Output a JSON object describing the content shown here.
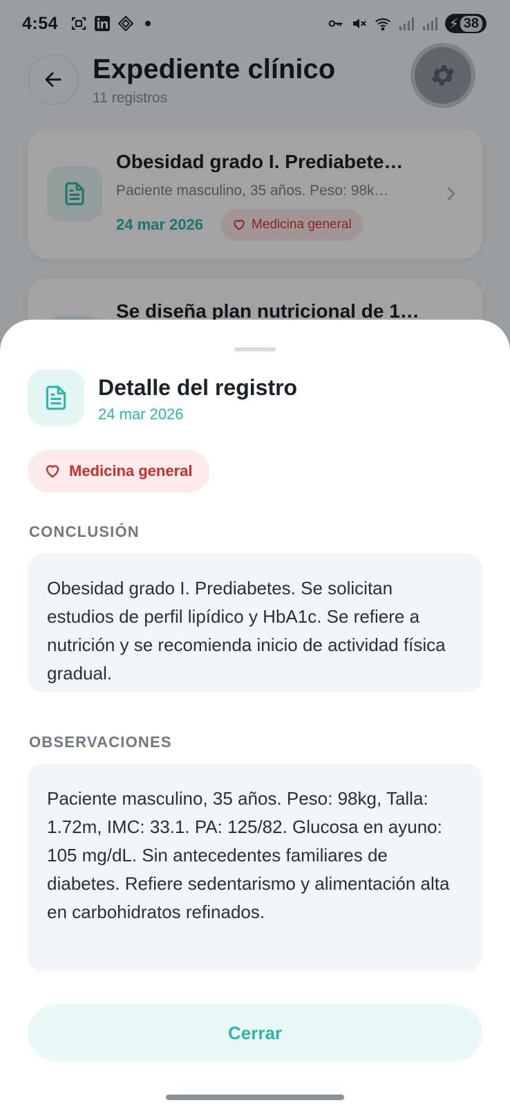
{
  "status_bar": {
    "time": "4:54",
    "battery": "38"
  },
  "header": {
    "title": "Expediente clínico",
    "subtitle": "11 registros"
  },
  "records": [
    {
      "title": "Obesidad grado I. Prediabete…",
      "description": "Paciente masculino, 35 años. Peso: 98k…",
      "date": "24 mar 2026",
      "tag": "Medicina general"
    },
    {
      "title": "Se diseña plan nutricional de 1…"
    }
  ],
  "sheet": {
    "title": "Detalle del registro",
    "date": "24 mar 2026",
    "tag": "Medicina general",
    "conclusion_label": "CONCLUSIÓN",
    "conclusion_text": "Obesidad grado I. Prediabetes. Se solicitan estudios de perfil lipídico y HbA1c. Se refiere a nutrición y se recomienda inicio de actividad física gradual.",
    "observations_label": "OBSERVACIONES",
    "observations_text": "Paciente masculino, 35 años. Peso: 98kg, Talla: 1.72m, IMC: 33.1. PA: 125/82. Glucosa en ayuno: 105 mg/dL. Sin antecedentes familiares de diabetes. Refiere sedentarismo y alimentación alta en carbohidratos refinados.",
    "close_label": "Cerrar"
  },
  "colors": {
    "accent": "#2cb8a8",
    "tag_red": "#c92f2f",
    "tag_bg": "#fdeaea"
  }
}
